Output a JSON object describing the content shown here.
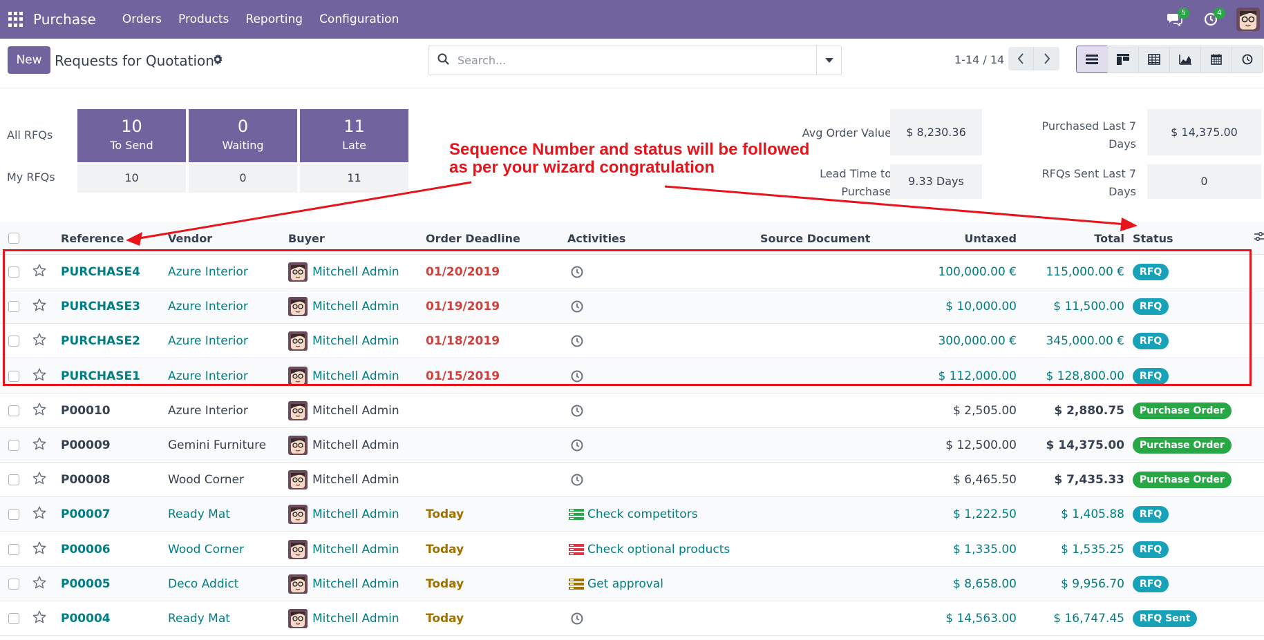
{
  "nav": {
    "brand": "Purchase",
    "menu": [
      "Orders",
      "Products",
      "Reporting",
      "Configuration"
    ],
    "chat_count": "5",
    "activity_count": "4"
  },
  "control": {
    "new_label": "New",
    "title": "Requests for Quotation",
    "search_placeholder": "Search...",
    "pager": "1-14 / 14"
  },
  "dashboard": {
    "all_label": "All RFQs",
    "my_label": "My RFQs",
    "tiles": [
      {
        "count": "10",
        "label": "To Send",
        "mine": "10"
      },
      {
        "count": "0",
        "label": "Waiting",
        "mine": "0"
      },
      {
        "count": "11",
        "label": "Late",
        "mine": "11"
      }
    ],
    "avg_label": "Avg Order Value",
    "avg_value": "$ 8,230.36",
    "lead_label_1": "Lead Time to",
    "lead_label_2": "Purchase",
    "lead_value": "9.33 Days",
    "purchased_label_1": "Purchased Last 7",
    "purchased_label_2": "Days",
    "purchased_value": "$ 14,375.00",
    "sent_label_1": "RFQs Sent Last 7",
    "sent_label_2": "Days",
    "sent_value": "0"
  },
  "annotation": {
    "line1": "Sequence Number and status will be followed",
    "line2": "as per your wizard congratulation"
  },
  "table": {
    "headers": {
      "reference": "Reference",
      "vendor": "Vendor",
      "buyer": "Buyer",
      "deadline": "Order Deadline",
      "activities": "Activities",
      "source": "Source Document",
      "untaxed": "Untaxed",
      "total": "Total",
      "status": "Status"
    },
    "rows": [
      {
        "ref": "PURCHASE4",
        "vendor": "Azure Interior",
        "buyer": "Mitchell Admin",
        "deadline": "01/20/2019",
        "activity": "",
        "untaxed": "100,000.00 €",
        "total": "115,000.00 €",
        "status": "RFQ"
      },
      {
        "ref": "PURCHASE3",
        "vendor": "Azure Interior",
        "buyer": "Mitchell Admin",
        "deadline": "01/19/2019",
        "activity": "",
        "untaxed": "$ 10,000.00",
        "total": "$ 11,500.00",
        "status": "RFQ"
      },
      {
        "ref": "PURCHASE2",
        "vendor": "Azure Interior",
        "buyer": "Mitchell Admin",
        "deadline": "01/18/2019",
        "activity": "",
        "untaxed": "300,000.00 €",
        "total": "345,000.00 €",
        "status": "RFQ"
      },
      {
        "ref": "PURCHASE1",
        "vendor": "Azure Interior",
        "buyer": "Mitchell Admin",
        "deadline": "01/15/2019",
        "activity": "",
        "untaxed": "$ 112,000.00",
        "total": "$ 128,800.00",
        "status": "RFQ"
      },
      {
        "ref": "P00010",
        "vendor": "Azure Interior",
        "buyer": "Mitchell Admin",
        "deadline": "",
        "activity": "",
        "untaxed": "$ 2,505.00",
        "total": "$ 2,880.75",
        "status": "Purchase Order"
      },
      {
        "ref": "P00009",
        "vendor": "Gemini Furniture",
        "buyer": "Mitchell Admin",
        "deadline": "",
        "activity": "",
        "untaxed": "$ 12,500.00",
        "total": "$ 14,375.00",
        "status": "Purchase Order"
      },
      {
        "ref": "P00008",
        "vendor": "Wood Corner",
        "buyer": "Mitchell Admin",
        "deadline": "",
        "activity": "",
        "untaxed": "$ 6,465.50",
        "total": "$ 7,435.33",
        "status": "Purchase Order"
      },
      {
        "ref": "P00007",
        "vendor": "Ready Mat",
        "buyer": "Mitchell Admin",
        "deadline": "Today",
        "activity": "Check competitors",
        "untaxed": "$ 1,222.50",
        "total": "$ 1,405.88",
        "status": "RFQ"
      },
      {
        "ref": "P00006",
        "vendor": "Wood Corner",
        "buyer": "Mitchell Admin",
        "deadline": "Today",
        "activity": "Check optional products",
        "untaxed": "$ 1,335.00",
        "total": "$ 1,535.25",
        "status": "RFQ"
      },
      {
        "ref": "P00005",
        "vendor": "Deco Addict",
        "buyer": "Mitchell Admin",
        "deadline": "Today",
        "activity": "Get approval",
        "untaxed": "$ 8,658.00",
        "total": "$ 9,956.70",
        "status": "RFQ"
      },
      {
        "ref": "P00004",
        "vendor": "Ready Mat",
        "buyer": "Mitchell Admin",
        "deadline": "Today",
        "activity": "",
        "untaxed": "$ 14,563.00",
        "total": "$ 16,747.45",
        "status": "RFQ Sent"
      }
    ]
  },
  "colors": {
    "brand": "#71639e",
    "link": "#017e84",
    "overdue": "#d23f3a",
    "today": "#a07100",
    "badge_rfq": "#17a2b8",
    "badge_po": "#28a745",
    "annotation": "#e8141b"
  },
  "icons": [
    "apps-grid-icon",
    "chat-icon",
    "activity-clock-icon",
    "gear-icon",
    "search-icon",
    "caret-down-icon",
    "chevron-left-icon",
    "chevron-right-icon",
    "list-view-icon",
    "kanban-view-icon",
    "pivot-view-icon",
    "graph-view-icon",
    "calendar-view-icon",
    "activity-view-icon",
    "star-icon",
    "clock-icon",
    "column-settings-icon"
  ]
}
